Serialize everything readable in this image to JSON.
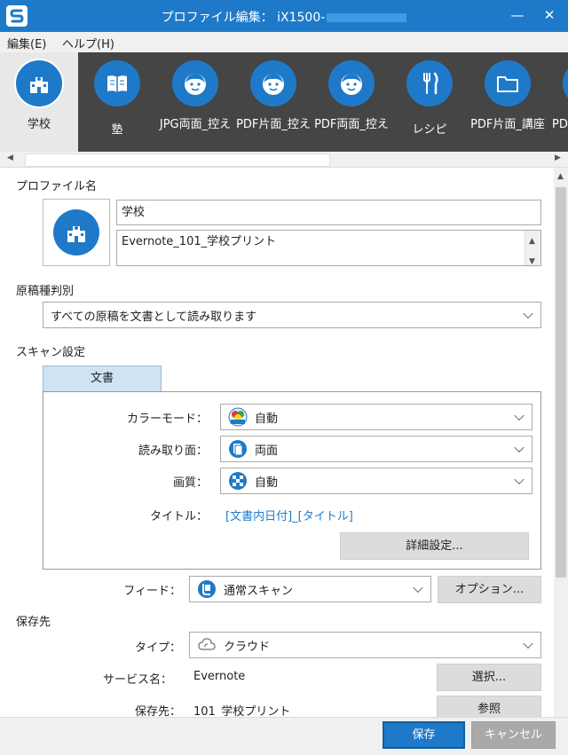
{
  "window": {
    "title": "プロファイル編集： iX1500-",
    "minimize": "—",
    "close": "✕"
  },
  "menu": [
    {
      "label": "編集(E)"
    },
    {
      "label": "ヘルプ(H)"
    }
  ],
  "profiles": [
    {
      "label": "学校",
      "icon": "school-icon"
    },
    {
      "label": "塾",
      "icon": "book-icon"
    },
    {
      "label": "JPG両面_控え",
      "icon": "face-icon"
    },
    {
      "label": "PDF片面_控え",
      "icon": "face-icon"
    },
    {
      "label": "PDF両面_控え",
      "icon": "face-icon"
    },
    {
      "label": "レシピ",
      "icon": "fork-knife-icon"
    },
    {
      "label": "PDF片面_講座",
      "icon": "folder-icon"
    },
    {
      "label": "PD",
      "icon": "folder-icon"
    }
  ],
  "profile_name": {
    "section_label": "プロファイル名",
    "name_value": "学校",
    "comment_value": "Evernote_101_学校プリント"
  },
  "document_type": {
    "section_label": "原稿種判別",
    "selected": "すべての原稿を文書として読み取ります"
  },
  "scan_settings": {
    "section_label": "スキャン設定",
    "tab_label": "文書",
    "color_mode_label": "カラーモード：",
    "color_mode_value": "自動",
    "scan_side_label": "読み取り面：",
    "scan_side_value": "両面",
    "quality_label": "画質：",
    "quality_value": "自動",
    "title_label": "タイトル：",
    "title_value": "[文書内日付]_[タイトル]",
    "detail_button": "詳細設定...",
    "feed_label": "フィード：",
    "feed_value": "通常スキャン",
    "option_button": "オプション..."
  },
  "save_to": {
    "section_label": "保存先",
    "type_label": "タイプ：",
    "type_value": "クラウド",
    "service_label": "サービス名：",
    "service_value": "Evernote",
    "select_button": "選択...",
    "folder_label": "保存先：",
    "folder_value": "101_学校プリント",
    "browse_button": "参照"
  },
  "footer": {
    "save_button": "保存",
    "cancel_button": "キャンセル"
  },
  "colors": {
    "accent": "#1e7ac9",
    "strip_bg": "#454545",
    "tab_bg": "#cfe3f5"
  }
}
